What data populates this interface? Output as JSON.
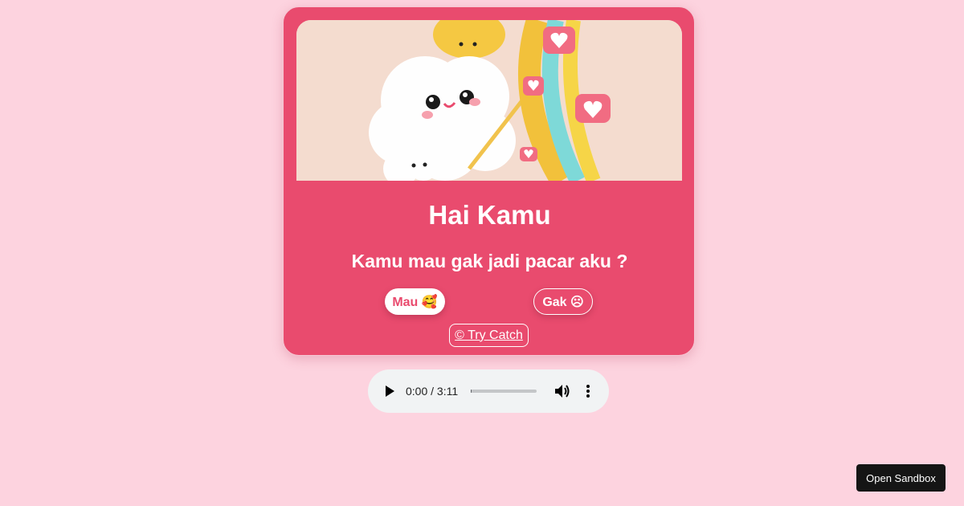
{
  "card": {
    "title": "Hai Kamu",
    "question": "Kamu mau gak jadi pacar aku ?",
    "yes_label": "Mau 🥰",
    "no_label": "Gak ☹",
    "credit_label": "© Try Catch",
    "accent_color": "#e94b6e"
  },
  "audio_player": {
    "time_display": "0:00 / 3:11",
    "progress": 0,
    "icons": [
      "play-icon",
      "volume-icon",
      "more-options-icon"
    ]
  },
  "sandbox_button": {
    "label": "Open Sandbox"
  },
  "colors": {
    "page_background": "#fdd3df",
    "card_background": "#e94b6e"
  }
}
